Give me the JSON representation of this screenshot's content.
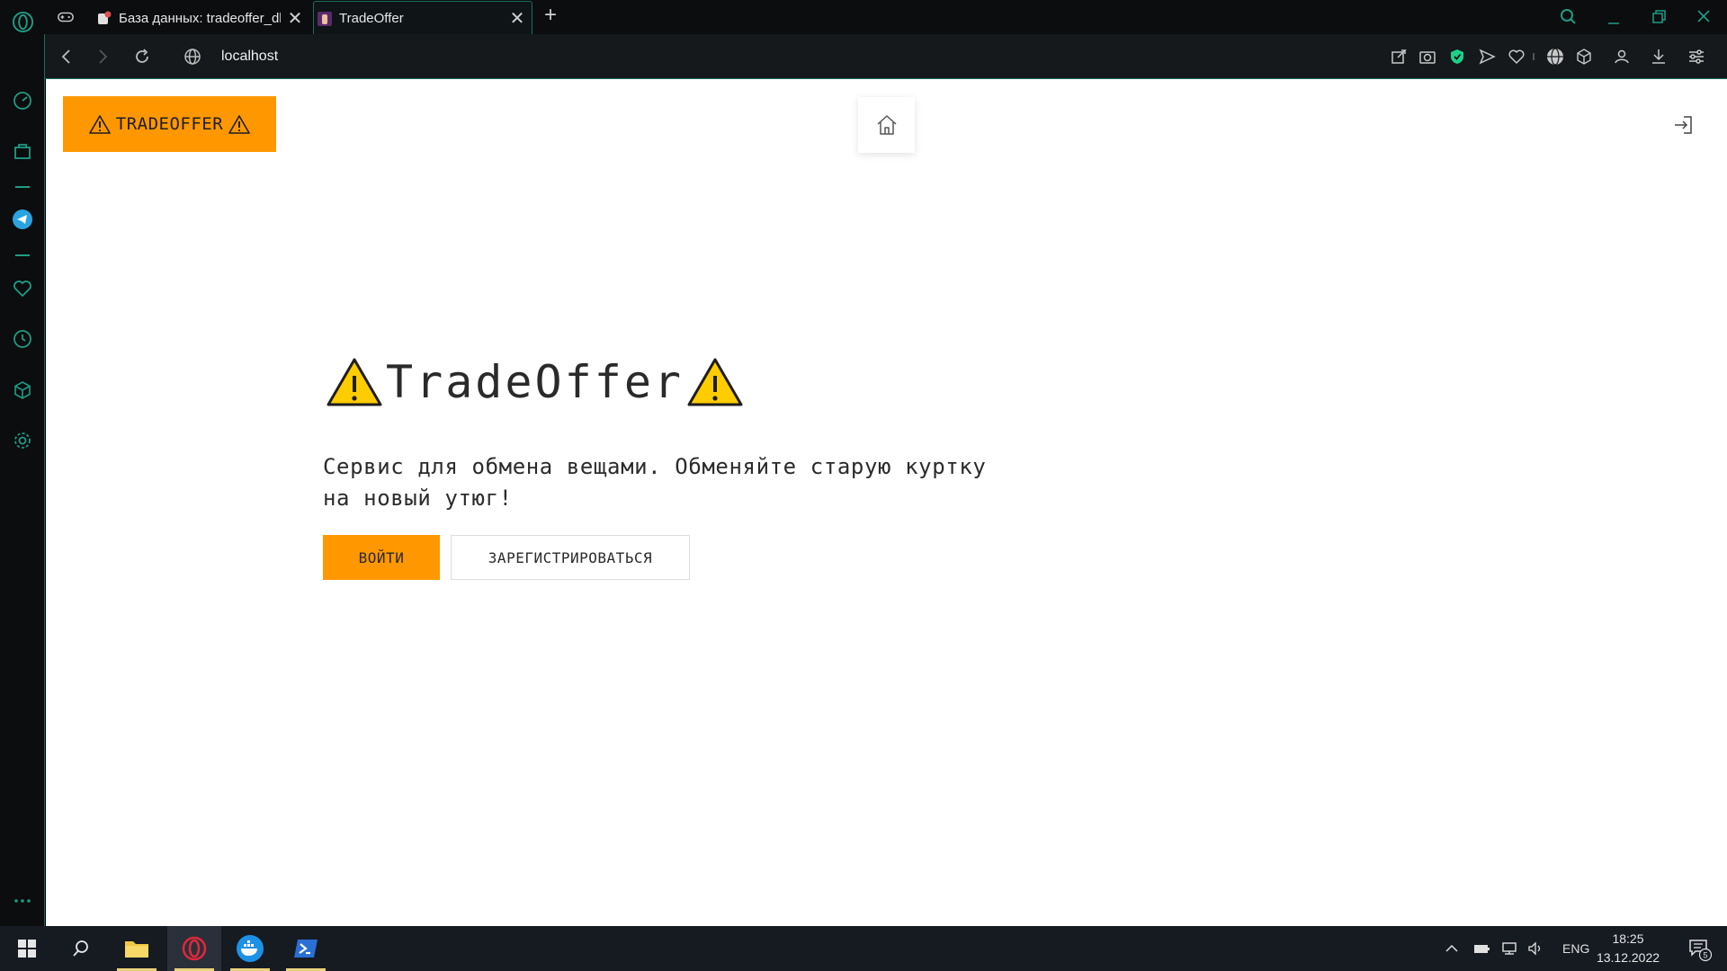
{
  "browser": {
    "tabs": [
      {
        "title": "База данных: tradeoffer_db"
      },
      {
        "title": "TradeOffer"
      }
    ],
    "url": "localhost",
    "new_tab_label": "+",
    "close_glyph": "✕"
  },
  "app": {
    "brand_label": "TRADEOFFER",
    "hero_title": "TradeOffer",
    "hero_description": "Сервис для обмена вещами. Обменяйте старую куртку на новый утюг!",
    "login_label": "ВОЙТИ",
    "register_label": "ЗАРЕГИСТРИРОВАТЬСЯ",
    "accent_color": "#ff9800"
  },
  "taskbar": {
    "language": "ENG",
    "time": "18:25",
    "date": "13.12.2022",
    "notification_count": "5"
  },
  "icons": [
    "opera-logo",
    "gx-icon",
    "back-icon",
    "forward-icon",
    "reload-icon",
    "globe-icon",
    "home-icon",
    "logout-icon",
    "warning-icon",
    "windows-icon",
    "search-icon"
  ]
}
